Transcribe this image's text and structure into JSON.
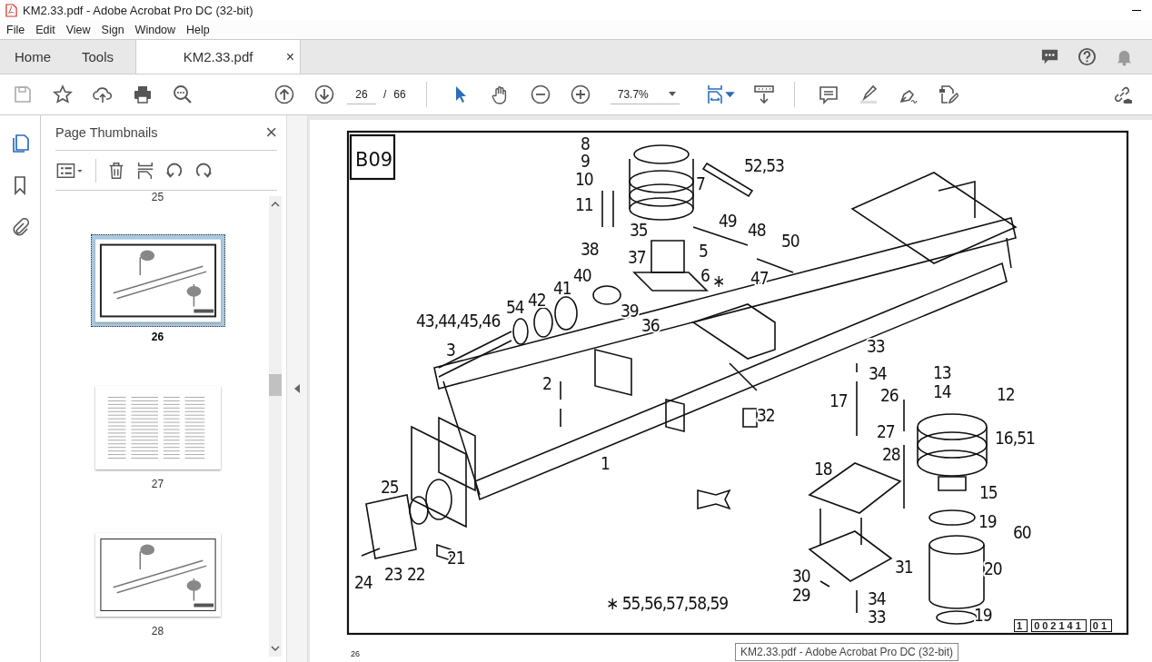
{
  "window": {
    "title": "KM2.33.pdf - Adobe Acrobat Pro DC (32-bit)"
  },
  "menu": [
    "File",
    "Edit",
    "View",
    "Sign",
    "Window",
    "Help"
  ],
  "tabs": [
    {
      "label": "Home",
      "selected": false
    },
    {
      "label": "Tools",
      "selected": false
    },
    {
      "label": "KM2.33.pdf",
      "selected": true
    }
  ],
  "tab_close": "×",
  "toolbar": {
    "page_current": "26",
    "page_separator": "/",
    "page_total": "66",
    "zoom": "73.7%"
  },
  "panel": {
    "title": "Page Thumbnails",
    "close": "×",
    "thumbnails": [
      {
        "label": "25",
        "selected": false,
        "kind": "none"
      },
      {
        "label": "26",
        "selected": true,
        "kind": "diagram"
      },
      {
        "label": "27",
        "selected": false,
        "kind": "table"
      },
      {
        "label": "28",
        "selected": false,
        "kind": "diagram"
      }
    ]
  },
  "page": {
    "corner_label": "B09",
    "page_number": "26",
    "callouts": [
      "8",
      "9",
      "10",
      "11",
      "7",
      "52,53",
      "35",
      "49",
      "48",
      "50",
      "38",
      "37",
      "5",
      "6",
      "∗",
      "47",
      "41",
      "40",
      "42",
      "54",
      "39",
      "36",
      "43,44,45,46",
      "3",
      "33",
      "34",
      "2",
      "26",
      "13",
      "14",
      "12",
      "17",
      "32",
      "27",
      "16,51",
      "28",
      "1",
      "18",
      "25",
      "15",
      "19",
      "60",
      "21",
      "31",
      "20",
      "24",
      "23",
      "22",
      "30",
      "29",
      "34",
      "33",
      "∗ 55,56,57,58,59",
      "19"
    ],
    "code_boxes": [
      "1",
      "002141",
      "01"
    ]
  },
  "tooltip": "KM2.33.pdf - Adobe Acrobat Pro DC (32-bit)"
}
